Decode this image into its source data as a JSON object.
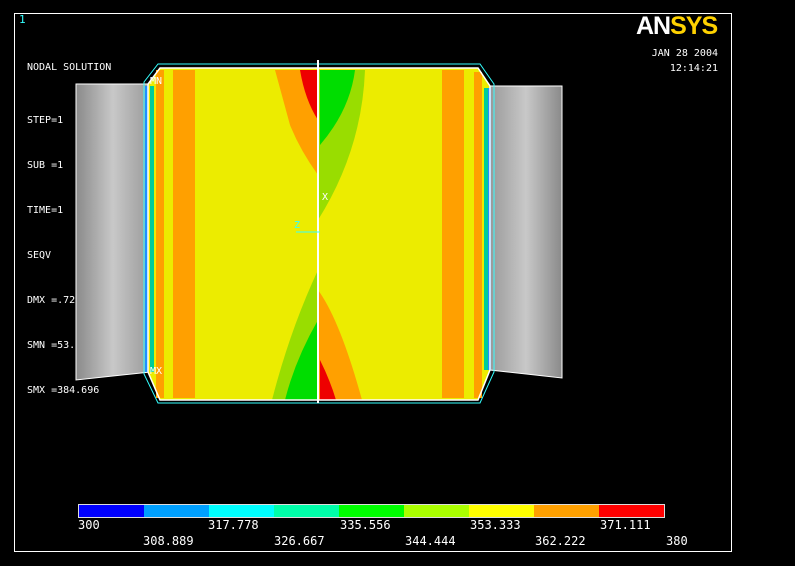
{
  "window_number": "1",
  "info": {
    "title": "NODAL SOLUTION",
    "lines": [
      "STEP=1",
      "SUB =1",
      "TIME=1",
      "SEQV     (AVG)",
      "DMX =.729949",
      "SMN =53.522",
      "SMX =384.696"
    ]
  },
  "logo": {
    "an": "AN",
    "sys": "SYS"
  },
  "date": "JAN 28 2004",
  "time": "12:14:21",
  "markers": {
    "mn": "MN",
    "mx": "MX",
    "x": "X",
    "z": "Z"
  },
  "legend": {
    "colors": [
      "#0000ff",
      "#00a0ff",
      "#00ffff",
      "#00ffaa",
      "#00ff00",
      "#aaff00",
      "#ffff00",
      "#ffa000",
      "#ff0000"
    ],
    "upper_labels": [
      "300",
      "317.778",
      "335.556",
      "353.333",
      "371.111"
    ],
    "lower_labels": [
      "308.889",
      "326.667",
      "344.444",
      "362.222",
      "380"
    ]
  },
  "model_colors": {
    "end_caps": "#bdbdbd",
    "body": "#eeee00",
    "band": "#ffa000",
    "green": "#00dd00",
    "lightgreen": "#99dd00",
    "red": "#ee0000"
  }
}
